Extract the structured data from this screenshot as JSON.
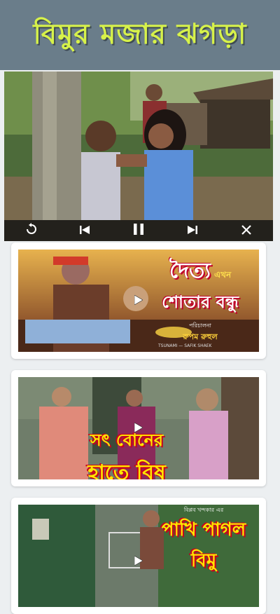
{
  "app": {
    "title": "বিমুর মজার ঝগড়া",
    "title_color": "#d7f24a",
    "banner_color": "#6a7d8a"
  },
  "player": {
    "state": "playing",
    "controls": [
      "replay-icon",
      "previous-icon",
      "pause-icon",
      "next-icon",
      "close-icon"
    ]
  },
  "videos": [
    {
      "title_line1": "দৈত্য",
      "title_small": "এখন",
      "title_line2": "শোতার বন্ধু",
      "credit_label": "পরিচালনা",
      "credit_name": "রুপম রুহুল",
      "watermark": "TSUNAMI — SAFIK SHAEK"
    },
    {
      "title_line1": "সৎ বোনের",
      "title_line2": "হাতে বিষ"
    },
    {
      "title_small": "বিপ্লব খন্দকার এর",
      "title_line1": "পাখি পাগল",
      "title_line2": "বিমু"
    }
  ]
}
